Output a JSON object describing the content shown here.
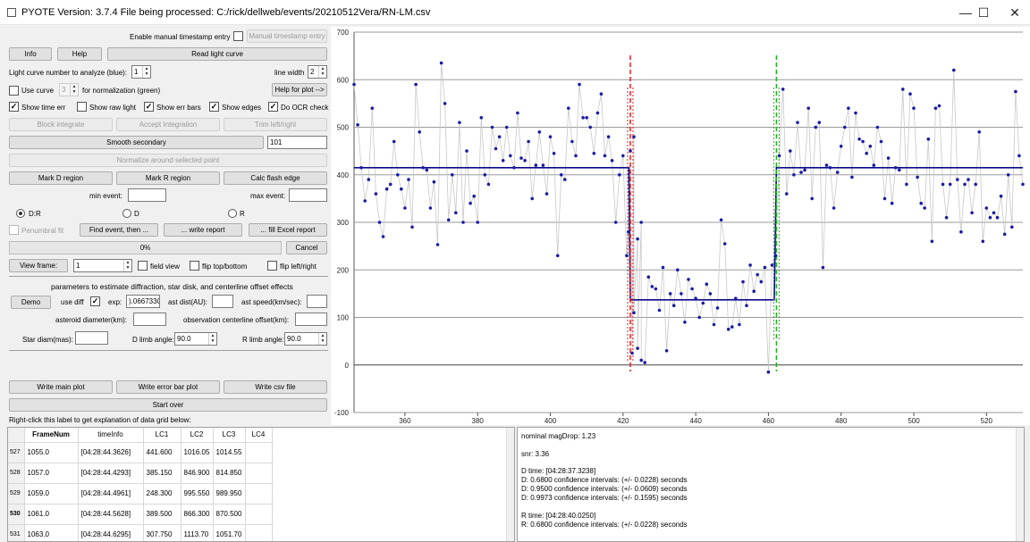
{
  "window": {
    "title": "PYOTE Version: 3.7.4  File being processed: C:/rick/dellweb/events/20210512Vera/RN-LM.csv",
    "min_label": "—",
    "max_label": "☐",
    "close_label": "✕"
  },
  "controls": {
    "enable_manual_ts": "Enable manual timestamp entry",
    "manual_ts_btn": "Manual timestamp entry",
    "info": "Info",
    "help": "Help",
    "read_lc": "Read light curve",
    "lc_number_label": "Light curve number to analyze (blue):",
    "lc_number": "1",
    "line_width_label": "line width",
    "line_width": "2",
    "use_curve": "Use curve",
    "use_curve_val": "3",
    "for_norm": "for normalization (green)",
    "help_plot": "Help for plot -->",
    "show_time_err": "Show time err",
    "show_raw_light": "Show raw light",
    "show_err_bars": "Show err bars",
    "show_edges": "Show edges",
    "do_ocr": "Do OCR check",
    "block_integrate": "Block integrate",
    "accept_integration": "Accept Integration",
    "trim": "Trim left/right",
    "smooth_secondary": "Smooth secondary",
    "smooth_val": "101",
    "normalize": "Normalize around selected point",
    "mark_d": "Mark D region",
    "mark_r": "Mark R region",
    "calc_flash": "Calc flash edge",
    "min_event": "min event:",
    "max_event": "max event:",
    "radio_dr": "D:R",
    "radio_d": "D",
    "radio_r": "R",
    "penumbral": "Penumbral fit",
    "find_event": "Find event, then ...",
    "write_report": "... write report",
    "fill_excel": "... fill Excel report",
    "progress": "0%",
    "cancel": "Cancel",
    "view_frame": "View frame:",
    "view_frame_val": "1",
    "field_view": "field view",
    "flip_tb": "flip top/bottom",
    "flip_lr": "flip left/right",
    "params_title": "parameters to estimate diffraction, star disk, and centerline offset effects",
    "demo": "Demo",
    "use_diff": "use diff",
    "exp_label": "exp:",
    "exp_val": ").0667330",
    "ast_dist": "ast dist(AU):",
    "ast_speed": "ast speed(km/sec):",
    "ast_diam": "asteroid diameter(km):",
    "obs_offset": "observation centerline offset(km):",
    "star_diam": "Star diam(mas):",
    "d_limb": "D limb angle:",
    "d_limb_val": "90.0",
    "r_limb": "R limb angle:",
    "r_limb_val": "90.0",
    "write_main": "Write main plot",
    "write_err": "Write error bar plot",
    "write_csv": "Write csv file",
    "start_over": "Start over",
    "rightclick": "Right-click this label to get explanation of data grid below:"
  },
  "grid": {
    "columns": [
      "FrameNum",
      "timeInfo",
      "LC1",
      "LC2",
      "LC3",
      "LC4"
    ],
    "rows": [
      {
        "rn": "527",
        "cells": [
          "1055.0",
          "[04:28:44.3626]",
          "441.600",
          "1016.05",
          "1014.55",
          ""
        ]
      },
      {
        "rn": "528",
        "cells": [
          "1057.0",
          "[04:28:44.4293]",
          "385.150",
          "846.900",
          "814.850",
          ""
        ]
      },
      {
        "rn": "529",
        "cells": [
          "1059.0",
          "[04:28:44.4961]",
          "248.300",
          "995.550",
          "989.950",
          ""
        ]
      },
      {
        "rn": "530",
        "cells": [
          "1061.0",
          "[04:28:44.5628]",
          "389.500",
          "866.300",
          "870.500",
          ""
        ]
      },
      {
        "rn": "531",
        "cells": [
          "1063.0",
          "[04:28:44.6295]",
          "307.750",
          "1113.70",
          "1051.70",
          ""
        ]
      }
    ]
  },
  "report": [
    "nominal magDrop: 1.23",
    "",
    "snr: 3.36",
    "",
    "D time: [04:28:37.3238]",
    "D: 0.6800 confidence intervals: (+/- 0.0228) seconds",
    "D: 0.9500 confidence intervals: (+/- 0.0609) seconds",
    "D: 0.9973 confidence intervals: (+/- 0.1595) seconds",
    "",
    "R time: [04:28:40.0250]",
    "R: 0.6800 confidence intervals: (+/- 0.0228) seconds"
  ],
  "chart_data": {
    "type": "scatter",
    "xlim": [
      346,
      530
    ],
    "ylim": [
      -100,
      700
    ],
    "x_ticks": [
      "360",
      "380",
      "400",
      "420",
      "440",
      "460",
      "480",
      "500",
      "520"
    ],
    "y_ticks": [
      "700",
      "600",
      "500",
      "400",
      "300",
      "200",
      "100",
      "0",
      "-100"
    ],
    "points": [
      [
        346,
        590
      ],
      [
        347,
        505
      ],
      [
        348,
        415
      ],
      [
        349,
        345
      ],
      [
        350,
        390
      ],
      [
        351,
        540
      ],
      [
        352,
        360
      ],
      [
        353,
        300
      ],
      [
        354,
        270
      ],
      [
        355,
        370
      ],
      [
        356,
        380
      ],
      [
        357,
        470
      ],
      [
        358,
        400
      ],
      [
        359,
        370
      ],
      [
        360,
        330
      ],
      [
        361,
        390
      ],
      [
        362,
        290
      ],
      [
        363,
        590
      ],
      [
        364,
        490
      ],
      [
        365,
        415
      ],
      [
        366,
        410
      ],
      [
        367,
        330
      ],
      [
        368,
        385
      ],
      [
        369,
        253
      ],
      [
        370,
        635
      ],
      [
        371,
        550
      ],
      [
        372,
        305
      ],
      [
        373,
        400
      ],
      [
        374,
        320
      ],
      [
        375,
        510
      ],
      [
        376,
        300
      ],
      [
        377,
        450
      ],
      [
        378,
        340
      ],
      [
        379,
        355
      ],
      [
        380,
        300
      ],
      [
        381,
        520
      ],
      [
        382,
        400
      ],
      [
        383,
        380
      ],
      [
        384,
        500
      ],
      [
        385,
        455
      ],
      [
        386,
        480
      ],
      [
        387,
        430
      ],
      [
        388,
        500
      ],
      [
        389,
        440
      ],
      [
        390,
        415
      ],
      [
        391,
        530
      ],
      [
        392,
        435
      ],
      [
        393,
        430
      ],
      [
        394,
        470
      ],
      [
        395,
        350
      ],
      [
        396,
        420
      ],
      [
        397,
        490
      ],
      [
        398,
        420
      ],
      [
        399,
        360
      ],
      [
        400,
        480
      ],
      [
        401,
        445
      ],
      [
        402,
        230
      ],
      [
        403,
        400
      ],
      [
        404,
        390
      ],
      [
        405,
        540
      ],
      [
        406,
        470
      ],
      [
        407,
        440
      ],
      [
        408,
        590
      ],
      [
        409,
        520
      ],
      [
        410,
        520
      ],
      [
        411,
        500
      ],
      [
        412,
        445
      ],
      [
        413,
        530
      ],
      [
        414,
        570
      ],
      [
        415,
        440
      ],
      [
        416,
        480
      ],
      [
        417,
        430
      ],
      [
        418,
        300
      ],
      [
        419,
        400
      ],
      [
        420,
        440
      ],
      [
        421,
        230
      ],
      [
        422,
        450
      ],
      [
        423,
        480
      ],
      [
        424,
        265
      ],
      [
        425,
        300
      ],
      [
        421.5,
        280
      ],
      [
        422.5,
        25
      ],
      [
        423,
        110
      ],
      [
        424,
        35
      ],
      [
        425,
        10
      ],
      [
        426,
        5
      ],
      [
        427,
        185
      ],
      [
        428,
        165
      ],
      [
        429,
        160
      ],
      [
        430,
        115
      ],
      [
        431,
        205
      ],
      [
        432,
        30
      ],
      [
        433,
        150
      ],
      [
        434,
        125
      ],
      [
        435,
        200
      ],
      [
        436,
        150
      ],
      [
        437,
        90
      ],
      [
        438,
        180
      ],
      [
        439,
        160
      ],
      [
        440,
        140
      ],
      [
        441,
        100
      ],
      [
        442,
        130
      ],
      [
        443,
        170
      ],
      [
        444,
        150
      ],
      [
        445,
        85
      ],
      [
        446,
        120
      ],
      [
        447,
        305
      ],
      [
        448,
        255
      ],
      [
        449,
        75
      ],
      [
        450,
        80
      ],
      [
        451,
        140
      ],
      [
        452,
        85
      ],
      [
        453,
        175
      ],
      [
        454,
        125
      ],
      [
        455,
        210
      ],
      [
        456,
        155
      ],
      [
        457,
        190
      ],
      [
        458,
        175
      ],
      [
        459,
        205
      ],
      [
        460,
        -15
      ],
      [
        461,
        210
      ],
      [
        462,
        230
      ],
      [
        463,
        440
      ],
      [
        464,
        580
      ],
      [
        465,
        360
      ],
      [
        466,
        450
      ],
      [
        467,
        400
      ],
      [
        468,
        510
      ],
      [
        469,
        405
      ],
      [
        470,
        410
      ],
      [
        471,
        540
      ],
      [
        472,
        350
      ],
      [
        473,
        500
      ],
      [
        474,
        510
      ],
      [
        475,
        205
      ],
      [
        476,
        420
      ],
      [
        477,
        415
      ],
      [
        478,
        330
      ],
      [
        479,
        405
      ],
      [
        480,
        460
      ],
      [
        481,
        500
      ],
      [
        482,
        540
      ],
      [
        483,
        395
      ],
      [
        484,
        530
      ],
      [
        485,
        475
      ],
      [
        486,
        470
      ],
      [
        487,
        445
      ],
      [
        488,
        460
      ],
      [
        489,
        420
      ],
      [
        490,
        500
      ],
      [
        491,
        470
      ],
      [
        492,
        350
      ],
      [
        493,
        435
      ],
      [
        494,
        340
      ],
      [
        495,
        415
      ],
      [
        496,
        410
      ],
      [
        497,
        580
      ],
      [
        498,
        380
      ],
      [
        499,
        570
      ],
      [
        500,
        540
      ],
      [
        501,
        395
      ],
      [
        502,
        340
      ],
      [
        503,
        330
      ],
      [
        504,
        475
      ],
      [
        505,
        260
      ],
      [
        506,
        540
      ],
      [
        507,
        545
      ],
      [
        508,
        380
      ],
      [
        509,
        310
      ],
      [
        510,
        380
      ],
      [
        511,
        620
      ],
      [
        512,
        390
      ],
      [
        513,
        280
      ],
      [
        514,
        380
      ],
      [
        515,
        390
      ],
      [
        516,
        320
      ],
      [
        517,
        380
      ],
      [
        518,
        490
      ],
      [
        519,
        260
      ],
      [
        520,
        330
      ],
      [
        521,
        310
      ],
      [
        522,
        320
      ],
      [
        523,
        310
      ],
      [
        524,
        355
      ],
      [
        525,
        275
      ],
      [
        526,
        400
      ],
      [
        527,
        290
      ],
      [
        528,
        575
      ],
      [
        529,
        440
      ],
      [
        530,
        380
      ]
    ],
    "levels": {
      "baseline": 415,
      "event": 137,
      "d_edge": 422,
      "r_edge": 462.2,
      "baseline_start": 346,
      "baseline_end": 530
    },
    "colors": {
      "points": "#1a1aa8",
      "line": "#c8c8c8",
      "fit": "#0a0a8a",
      "d_edge": "#e02020",
      "r_edge": "#20b020"
    }
  }
}
